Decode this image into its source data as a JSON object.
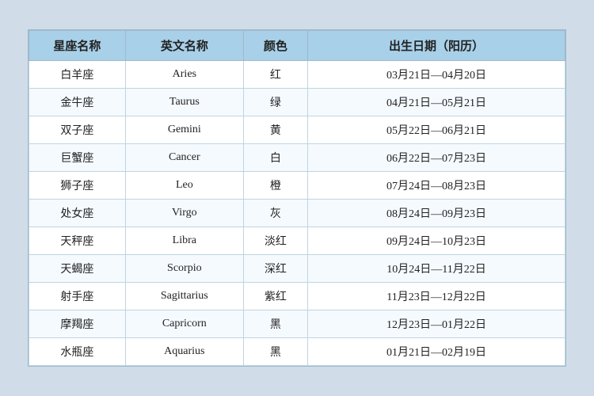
{
  "table": {
    "headers": [
      "星座名称",
      "英文名称",
      "颜色",
      "出生日期（阳历）"
    ],
    "rows": [
      {
        "cn": "白羊座",
        "en": "Aries",
        "color": "红",
        "date": "03月21日—04月20日"
      },
      {
        "cn": "金牛座",
        "en": "Taurus",
        "color": "绿",
        "date": "04月21日—05月21日"
      },
      {
        "cn": "双子座",
        "en": "Gemini",
        "color": "黄",
        "date": "05月22日—06月21日"
      },
      {
        "cn": "巨蟹座",
        "en": "Cancer",
        "color": "白",
        "date": "06月22日—07月23日"
      },
      {
        "cn": "狮子座",
        "en": "Leo",
        "color": "橙",
        "date": "07月24日—08月23日"
      },
      {
        "cn": "处女座",
        "en": "Virgo",
        "color": "灰",
        "date": "08月24日—09月23日"
      },
      {
        "cn": "天秤座",
        "en": "Libra",
        "color": "淡红",
        "date": "09月24日—10月23日"
      },
      {
        "cn": "天蝎座",
        "en": "Scorpio",
        "color": "深红",
        "date": "10月24日—11月22日"
      },
      {
        "cn": "射手座",
        "en": "Sagittarius",
        "color": "紫红",
        "date": "11月23日—12月22日"
      },
      {
        "cn": "摩羯座",
        "en": "Capricorn",
        "color": "黑",
        "date": "12月23日—01月22日"
      },
      {
        "cn": "水瓶座",
        "en": "Aquarius",
        "color": "黑",
        "date": "01月21日—02月19日"
      }
    ]
  }
}
